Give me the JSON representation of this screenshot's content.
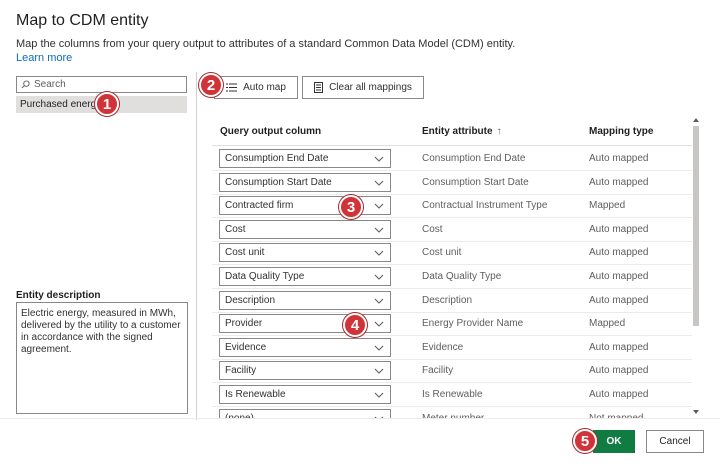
{
  "dialog": {
    "title": "Map to CDM entity",
    "description": "Map the columns from your query output to attributes of a standard Common Data Model (CDM) entity.",
    "learn_more": "Learn more"
  },
  "left": {
    "search_placeholder": "Search",
    "entity": "Purchased energy",
    "entity_description_label": "Entity description",
    "entity_description": "Electric energy, measured in MWh, delivered by the utility to a customer in accordance with the signed agreement."
  },
  "toolbar": {
    "auto_map": "Auto map",
    "clear_all": "Clear all mappings"
  },
  "table": {
    "headers": [
      "Query output column",
      "Entity attribute",
      "Mapping type"
    ],
    "rows": [
      {
        "column": "Consumption End Date",
        "attribute": "Consumption End Date",
        "type": "Auto mapped"
      },
      {
        "column": "Consumption Start Date",
        "attribute": "Consumption Start Date",
        "type": "Auto mapped"
      },
      {
        "column": "Contracted firm",
        "attribute": "Contractual Instrument Type",
        "type": "Mapped"
      },
      {
        "column": "Cost",
        "attribute": "Cost",
        "type": "Auto mapped"
      },
      {
        "column": "Cost unit",
        "attribute": "Cost unit",
        "type": "Auto mapped"
      },
      {
        "column": "Data Quality Type",
        "attribute": "Data Quality Type",
        "type": "Auto mapped"
      },
      {
        "column": "Description",
        "attribute": "Description",
        "type": "Auto mapped"
      },
      {
        "column": "Provider",
        "attribute": "Energy Provider Name",
        "type": "Mapped"
      },
      {
        "column": "Evidence",
        "attribute": "Evidence",
        "type": "Auto mapped"
      },
      {
        "column": "Facility",
        "attribute": "Facility",
        "type": "Auto mapped"
      },
      {
        "column": "Is Renewable",
        "attribute": "Is Renewable",
        "type": "Auto mapped"
      },
      {
        "column": "(none)",
        "attribute": "Meter number",
        "type": "Not mapped"
      }
    ]
  },
  "footer": {
    "ok": "OK",
    "cancel": "Cancel"
  },
  "badges": [
    "1",
    "2",
    "3",
    "4",
    "5"
  ],
  "colors": {
    "accent": "#107c41",
    "badge": "#d13438",
    "link": "#0f6cbd"
  }
}
